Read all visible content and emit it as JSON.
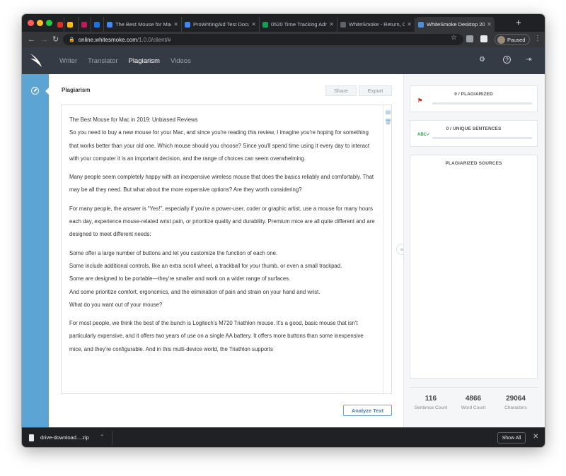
{
  "browser": {
    "tabs": [
      {
        "title": "",
        "icon": "gmail-icon",
        "color": "#d93025"
      },
      {
        "title": "",
        "icon": "google-drive-icon",
        "color": "#fbbc04"
      },
      {
        "title": "",
        "icon": "t-app-icon",
        "color": "#c2185b"
      },
      {
        "title": "",
        "icon": "go-icon",
        "color": "#1a73e8"
      },
      {
        "title": "The Best Mouse for Mac",
        "icon": "google-docs-icon",
        "color": "#4285f4"
      },
      {
        "title": "ProWritingAid Test Docu",
        "icon": "google-docs-icon",
        "color": "#4285f4"
      },
      {
        "title": "0520 Time Tracking Adm",
        "icon": "google-sheets-icon",
        "color": "#0f9d58"
      },
      {
        "title": "WhiteSmoke - Return, G",
        "icon": "loading-icon",
        "color": "#5f6368"
      },
      {
        "title": "WhiteSmoke Desktop 20",
        "icon": "whitesmoke-icon",
        "color": "#4a90d9"
      }
    ],
    "url_host": "online.whitesmoke.com",
    "url_path": "/1.0.0/client/#",
    "profile_status": "Paused"
  },
  "app": {
    "nav": [
      "Writer",
      "Translator",
      "Plagiarism",
      "Videos"
    ],
    "active_nav": "Plagiarism"
  },
  "panel": {
    "title": "Plagiarism",
    "share_label": "Share",
    "export_label": "Export",
    "analyze_label": "Analyze Text"
  },
  "document": {
    "paragraphs": [
      "The Best Mouse for Mac in 2019: Unbiased Reviews\nSo you need to buy a new mouse for your Mac, and since you're reading this review, I imagine you're hoping for something that works better than your old one. Which mouse should you choose? Since you'll spend time using it every day to interact with your computer it is an important decision, and the range of choices can seem overwhelming.",
      "Many people seem completely happy with an inexpensive wireless mouse that does the basics reliably and comfortably. That may be all they need. But what about the more expensive options? Are they worth considering?",
      "For many people, the answer is “Yes!”, especially if you're a power-user, coder or graphic artist, use a mouse for many hours each day, experience mouse-related wrist pain, or prioritize quality and durability. Premium mice are all quite different and are designed to meet different needs:",
      "Some offer a large number of buttons and let you customize the function of each one.\nSome include additional controls, like an extra scroll wheel, a trackball for your thumb, or even a small trackpad.\nSome are designed to be portable—they're smaller and work on a wider range of surfaces.\nAnd some prioritize comfort, ergonomics, and the elimination of pain and strain on your hand and wrist.\nWhat do you want out of your mouse?",
      "For most people, we think the best of the bunch is Logitech's M720 Triathlon mouse. It's a good, basic mouse that isn't particularly expensive, and it offers two years of use on a single AA battery. It offers more buttons than some inexpensive mice, and they're configurable. And in this multi-device world, the Triathlon supports"
    ]
  },
  "results": {
    "plagiarized_label": "0 / PLAGIARIZED",
    "plagiarized_fraction": 0,
    "unique_label": "0 / UNIQUE SENTENCES",
    "unique_fraction": 0,
    "sources_label": "PLAGIARIZED SOURCES"
  },
  "stats": [
    {
      "value": "116",
      "label": "Sentence Count"
    },
    {
      "value": "4866",
      "label": "Word Count"
    },
    {
      "value": "29064",
      "label": "Characters"
    }
  ],
  "download": {
    "filename": "drive-download....zip",
    "show_all_label": "Show All"
  }
}
